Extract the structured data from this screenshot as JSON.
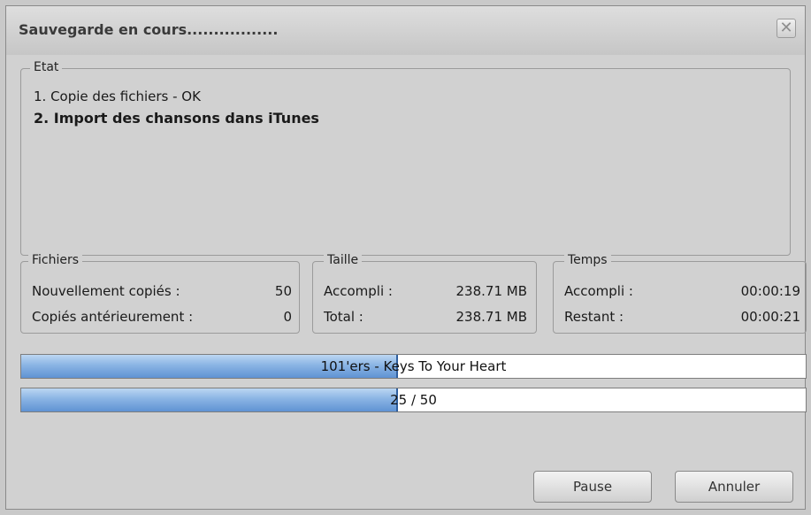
{
  "window": {
    "title": "Sauvegarde en cours.................",
    "close_glyph": "✕"
  },
  "etat": {
    "legend": "Etat",
    "lines": [
      "1. Copie des fichiers - OK",
      "2. Import des chansons dans iTunes"
    ]
  },
  "fichiers": {
    "legend": "Fichiers",
    "rows": [
      {
        "label": "Nouvellement copiés :",
        "value": "50"
      },
      {
        "label": "Copiés antérieurement :",
        "value": "0"
      }
    ]
  },
  "taille": {
    "legend": "Taille",
    "rows": [
      {
        "label": "Accompli :",
        "value": "238.71 MB"
      },
      {
        "label": "Total :",
        "value": "238.71 MB"
      }
    ]
  },
  "temps": {
    "legend": "Temps",
    "rows": [
      {
        "label": "Accompli :",
        "value": "00:00:19"
      },
      {
        "label": "Restant :",
        "value": "00:00:21"
      }
    ]
  },
  "progress": {
    "file": {
      "text": "101'ers - Keys To Your Heart",
      "percent": 48
    },
    "overall": {
      "text": "25 / 50",
      "percent": 48
    }
  },
  "buttons": {
    "pause": "Pause",
    "cancel": "Annuler"
  },
  "colors": {
    "progress_fill": "#8ab4e4",
    "progress_edge": "#2f5f9f"
  }
}
